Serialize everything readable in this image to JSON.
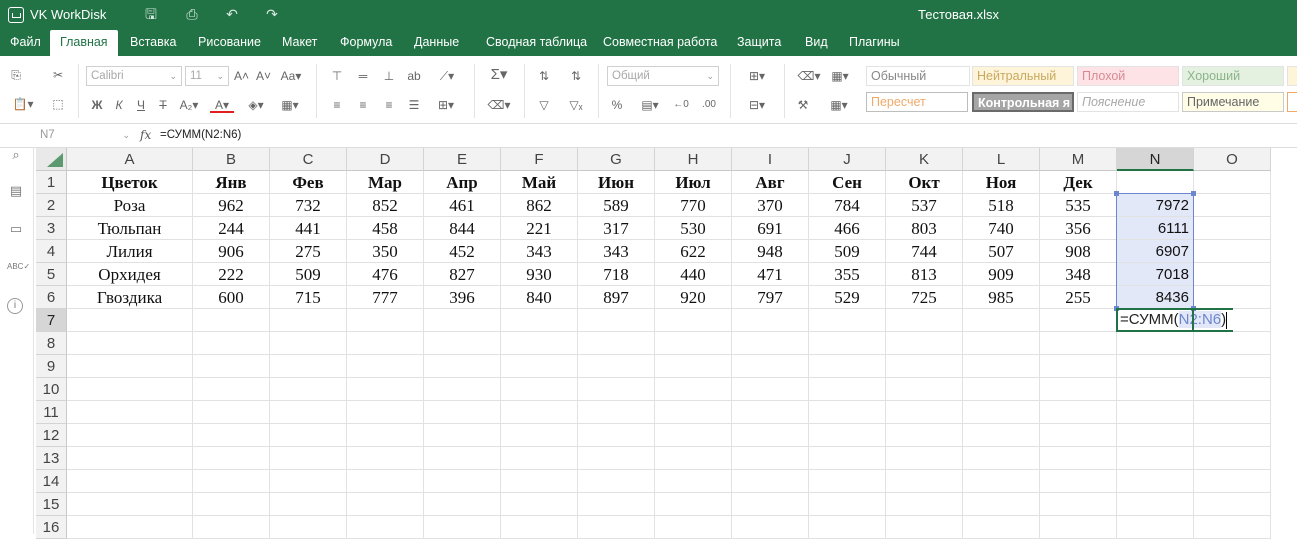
{
  "app": {
    "name": "VK WorkDisk",
    "document": "Тестовая.xlsx"
  },
  "menu": [
    "Файл",
    "Главная",
    "Вставка",
    "Рисование",
    "Макет",
    "Формула",
    "Данные",
    "Сводная таблица",
    "Совместная работа",
    "Защита",
    "Вид",
    "Плагины"
  ],
  "menu_active": "Главная",
  "ribbon": {
    "font_name": "Calibri",
    "font_size": "11",
    "number_format": "Общий",
    "styles_row1": [
      "Обычный",
      "Нейтральный",
      "Плохой",
      "Хороший"
    ],
    "styles_row2": [
      "Пересчет",
      "Контрольная я",
      "Пояснение",
      "Примечание"
    ],
    "style_colors": {
      "neutral_bg": "#fdf4d9",
      "bad_bg": "#fde3e6",
      "good_bg": "#e4f1e0",
      "note_bg": "#fffde6",
      "check_bg": "#a5a5a5"
    }
  },
  "formula_bar": {
    "name_box": "N7",
    "fx": "fx",
    "formula": "=СУММ(N2:N6)"
  },
  "columns": [
    "A",
    "B",
    "C",
    "D",
    "E",
    "F",
    "G",
    "H",
    "I",
    "J",
    "K",
    "L",
    "M",
    "N",
    "O"
  ],
  "selected_column": "N",
  "row_numbers": [
    "1",
    "2",
    "3",
    "4",
    "5",
    "6",
    "7",
    "8",
    "9",
    "10",
    "11",
    "12",
    "13",
    "14",
    "15",
    "16"
  ],
  "table": {
    "header": [
      "Цветок",
      "Янв",
      "Фев",
      "Мар",
      "Апр",
      "Май",
      "Июн",
      "Июл",
      "Авг",
      "Сен",
      "Окт",
      "Ноя",
      "Дек"
    ],
    "rows": [
      {
        "name": "Роза",
        "values": [
          "962",
          "732",
          "852",
          "461",
          "862",
          "589",
          "770",
          "370",
          "784",
          "537",
          "518",
          "535"
        ],
        "total": "7972"
      },
      {
        "name": "Тюльпан",
        "values": [
          "244",
          "441",
          "458",
          "844",
          "221",
          "317",
          "530",
          "691",
          "466",
          "803",
          "740",
          "356"
        ],
        "total": "6111"
      },
      {
        "name": "Лилия",
        "values": [
          "906",
          "275",
          "350",
          "452",
          "343",
          "343",
          "622",
          "948",
          "509",
          "744",
          "507",
          "908"
        ],
        "total": "6907"
      },
      {
        "name": "Орхидея",
        "values": [
          "222",
          "509",
          "476",
          "827",
          "930",
          "718",
          "440",
          "471",
          "355",
          "813",
          "909",
          "348"
        ],
        "total": "7018"
      },
      {
        "name": "Гвоздика",
        "values": [
          "600",
          "715",
          "777",
          "396",
          "840",
          "897",
          "920",
          "797",
          "529",
          "725",
          "985",
          "255"
        ],
        "total": "8436"
      }
    ]
  },
  "edit_cell": {
    "prefix": "=СУММ(",
    "ref": "N2:N6",
    "suffix": ")"
  },
  "sidebar_icons": [
    "search-icon",
    "comment-icon",
    "chat-icon",
    "spellcheck-icon",
    "info-icon"
  ],
  "colors": {
    "accent": "#217346",
    "selection": "#6d87cf",
    "selection_fill": "#e3e8f8"
  }
}
